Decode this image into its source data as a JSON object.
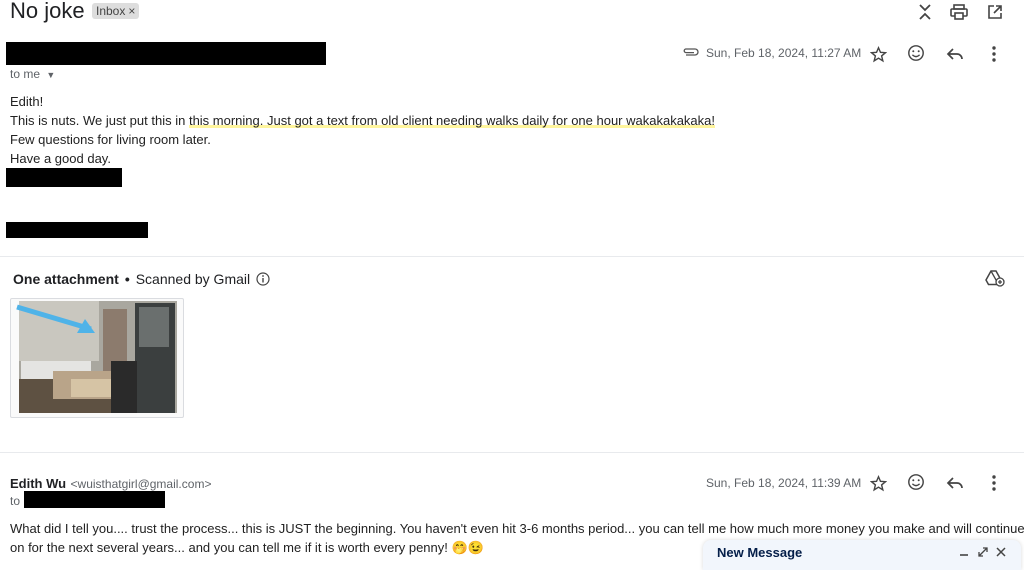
{
  "thread": {
    "subject": "No joke",
    "label_chip": "Inbox",
    "label_remove": "×"
  },
  "message1": {
    "to_label": "to me",
    "date": "Sun, Feb 18, 2024, 11:27 AM",
    "lines": [
      "Edith!",
      "This is nuts. We just put this in ",
      "this morning. Just got a text from old client needing walks daily for one hour wakakakakaka!",
      "Few questions for living room later.",
      "Have a good day."
    ]
  },
  "attachments": {
    "count_label": "One attachment",
    "separator": "•",
    "scan_label": "Scanned by Gmail"
  },
  "message2": {
    "sender_name": "Edith Wu",
    "sender_email": "<wuisthatgirl@gmail.com>",
    "to_label": "to",
    "date": "Sun, Feb 18, 2024, 11:39 AM",
    "line1": "What did I tell you.... trust the process... this is JUST the beginning.  You haven't even hit 3-6 months period... you can tell me how much more money you make and will continue",
    "line2": "on for the next several years... and you can tell me if it is worth every penny! 🤭😉"
  },
  "compose": {
    "title": "New Message"
  },
  "colors": {
    "highlight": "#fff59d",
    "arrow": "#4fb3e8"
  }
}
